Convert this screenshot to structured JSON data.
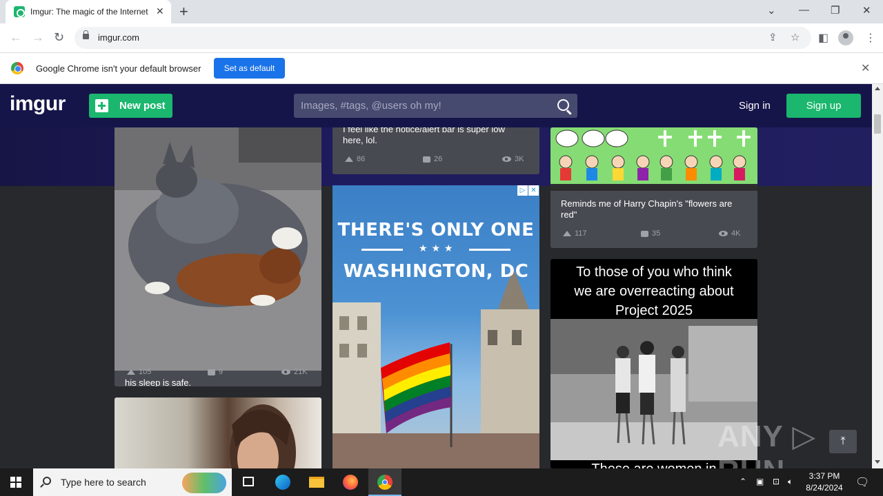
{
  "browser": {
    "tab_title": "Imgur: The magic of the Internet",
    "tab_close": "✕",
    "new_tab": "+",
    "url": "imgur.com",
    "win_minimize": "—",
    "win_restore": "❐",
    "win_close": "✕",
    "tab_search": "⌄"
  },
  "infobar": {
    "message": "Google Chrome isn't your default browser",
    "button": "Set as default",
    "close": "✕"
  },
  "imgur": {
    "logo": "imgur",
    "new_post": "New post",
    "search_placeholder": "Images, #tags, @users oh my!",
    "sign_in": "Sign in",
    "sign_up": "Sign up"
  },
  "posts": [
    {
      "title": "his sleep is safe.",
      "upvotes": "105",
      "comments": "9",
      "views": "21K"
    },
    {
      "title_line1": "I feel like the notice/alert bar is super low",
      "title_line2": "here, lol.",
      "upvotes": "86",
      "comments": "26",
      "views": "3K"
    },
    {
      "title_line1": "Reminds me of Harry Chapin's \"flowers are",
      "title_line2": "red\"",
      "upvotes": "117",
      "comments": "35",
      "views": "4K"
    },
    {
      "caption_line1": "To those of you who think",
      "caption_line2": "we are overreacting about",
      "caption_line3": "Project 2025",
      "bottom_text": "These are women in"
    }
  ],
  "ad": {
    "line1": "THERE'S ONLY ONE",
    "stars": "★ ★ ★",
    "line2": "WASHINGTON, DC",
    "badge_info": "▷",
    "badge_close": "✕"
  },
  "watermark": "ANY ▷ RUN",
  "scroll_top": "⤒",
  "taskbar": {
    "search_placeholder": "Type here to search",
    "time": "3:37 PM",
    "date": "8/24/2024"
  },
  "colors": {
    "imgur_green": "#1bb76e",
    "header_navy": "#16154a",
    "page_bg": "#27292d",
    "card_bg": "#474a51",
    "chrome_blue": "#1a73e8"
  }
}
